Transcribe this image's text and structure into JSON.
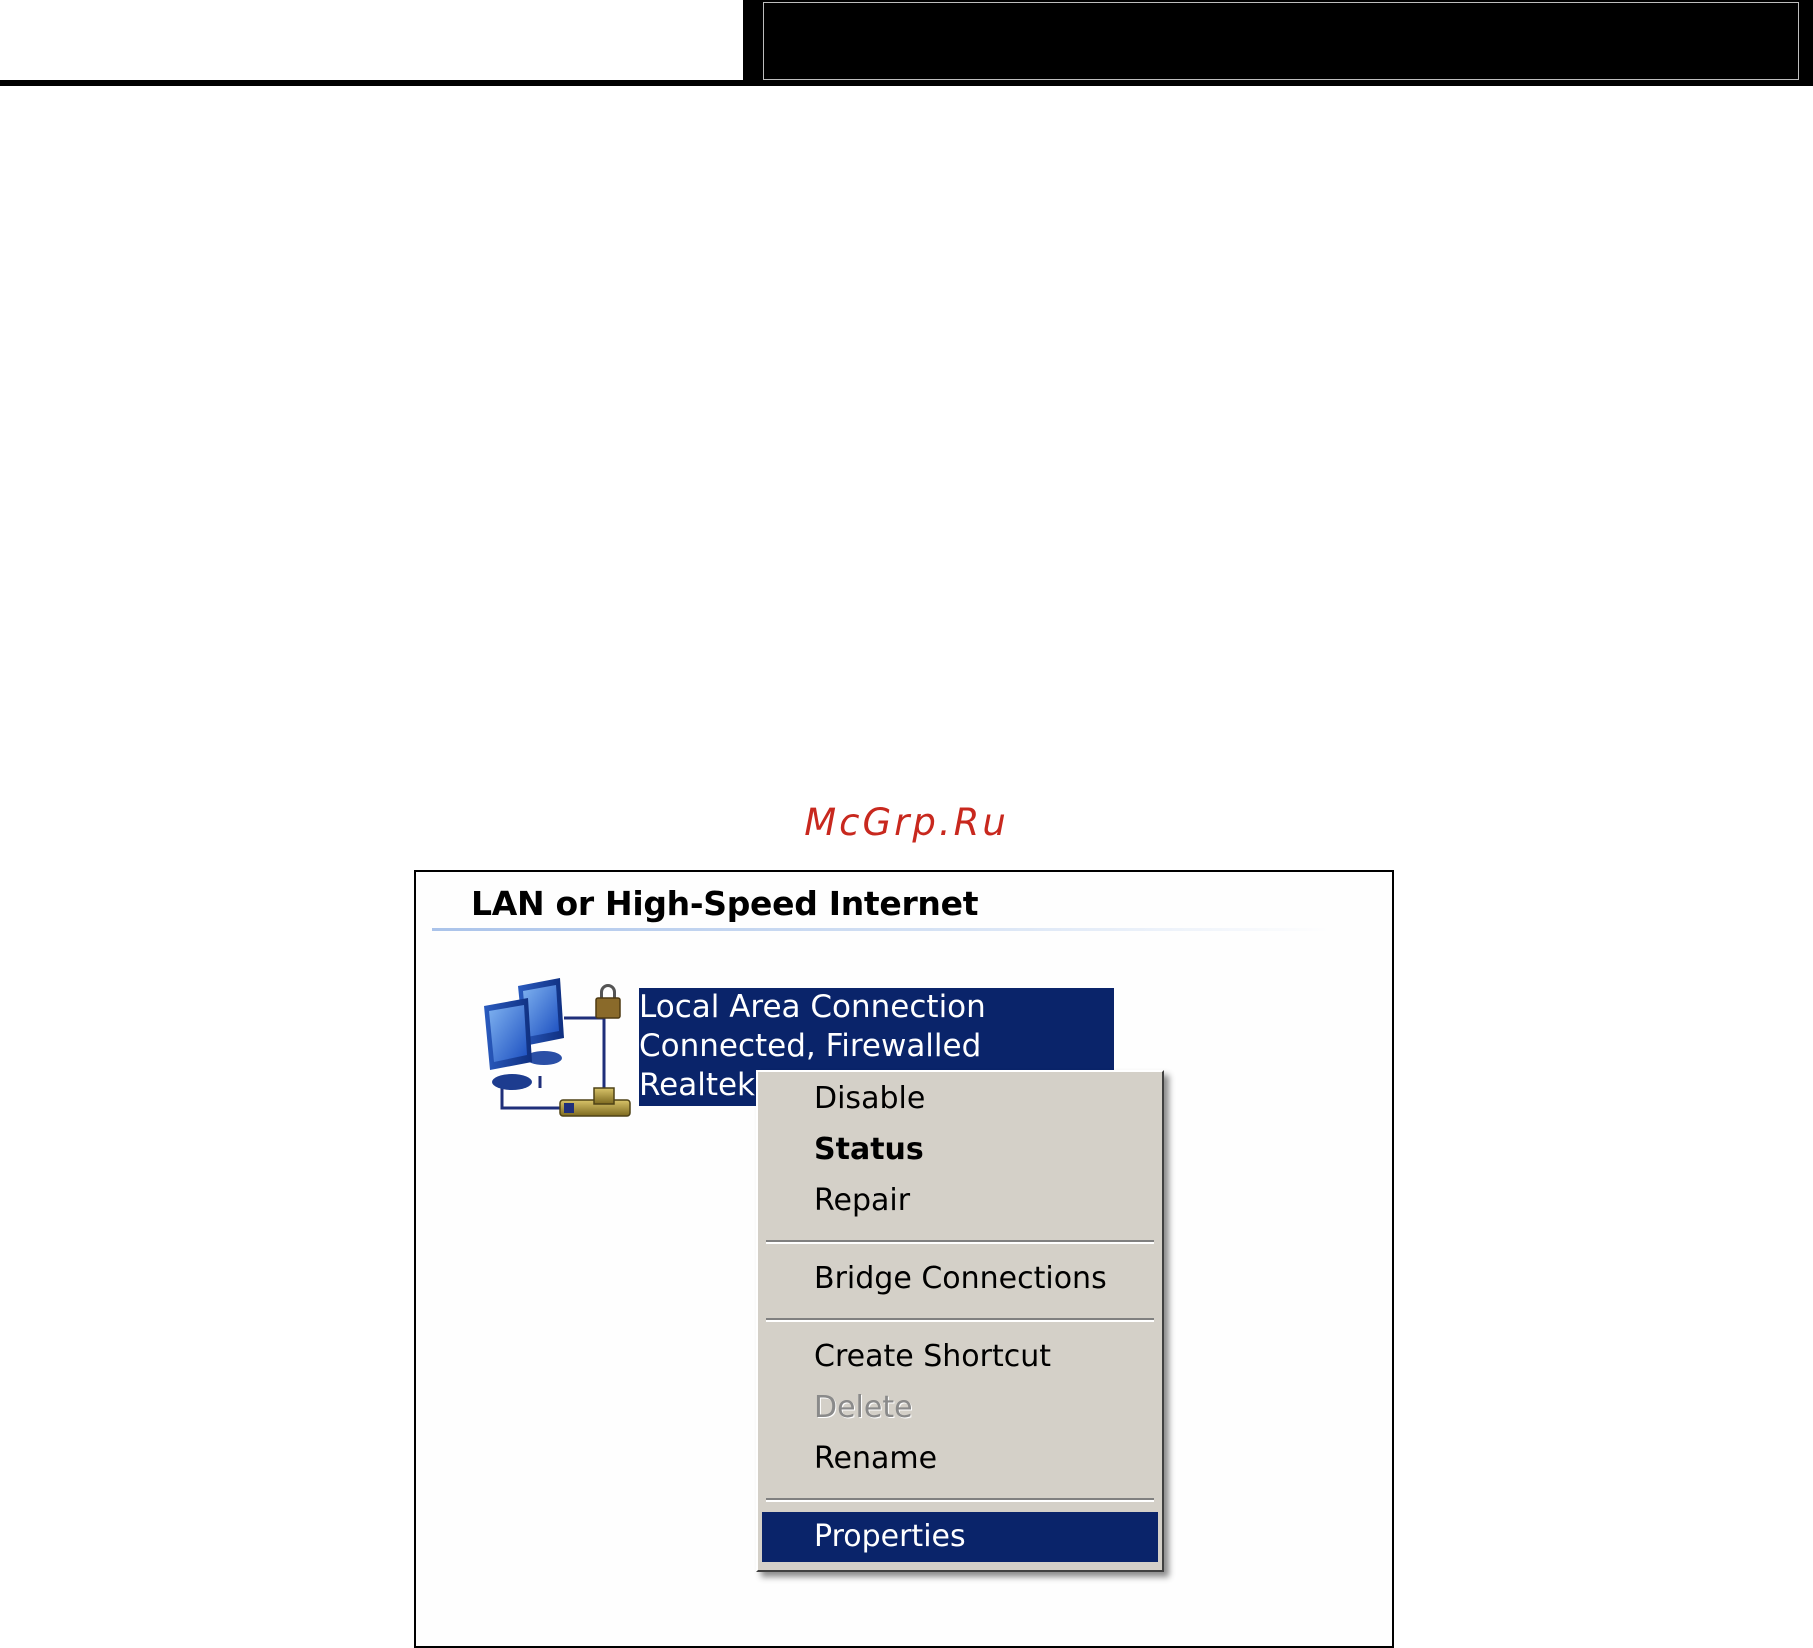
{
  "watermark": "McGrp.Ru",
  "panel": {
    "section_title": "LAN or High-Speed Internet"
  },
  "connection": {
    "icon": "network-connection-icon",
    "name": "Local Area Connection",
    "status": "Connected, Firewalled",
    "device": "Realtek"
  },
  "context_menu": {
    "items": [
      {
        "label": "Disable",
        "state": "normal"
      },
      {
        "label": "Status",
        "state": "default"
      },
      {
        "label": "Repair",
        "state": "normal"
      },
      {
        "label": "Bridge Connections",
        "state": "normal"
      },
      {
        "label": "Create Shortcut",
        "state": "normal"
      },
      {
        "label": "Delete",
        "state": "disabled"
      },
      {
        "label": "Rename",
        "state": "normal"
      },
      {
        "label": "Properties",
        "state": "selected"
      }
    ]
  },
  "colors": {
    "selection": "#0a246a",
    "menu_background": "#d4d0c8",
    "watermark": "#c8281e"
  }
}
